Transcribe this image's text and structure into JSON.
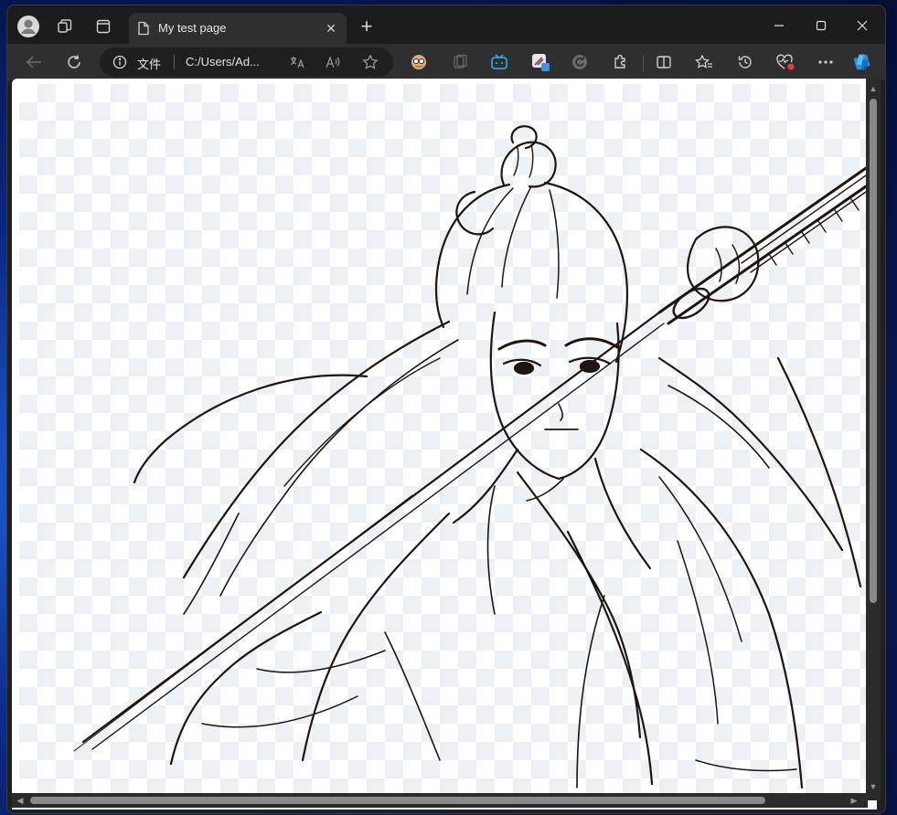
{
  "browser": {
    "tab": {
      "title": "My test page"
    },
    "address_bar": {
      "scheme_label": "文件",
      "url": "C:/Users/Ad..."
    },
    "icons": {
      "profile": "profile-icon",
      "workspaces": "workspaces-icon",
      "tab_actions": "tab-actions-icon",
      "new_tab": "plus-icon",
      "back": "back-arrow-icon",
      "refresh": "refresh-icon",
      "site_info": "info-icon",
      "translate": "translate-icon",
      "read_aloud": "read-aloud-icon",
      "favorite": "star-icon",
      "split_screen": "split-screen-icon",
      "favorites": "favorites-icon",
      "history": "history-icon",
      "performance": "heart-pulse-icon",
      "more": "more-icon",
      "copilot": "copilot-icon"
    },
    "accent": "#2f8fd8"
  },
  "page": {
    "image_type": "line-art sketch on transparent checkerboard"
  }
}
